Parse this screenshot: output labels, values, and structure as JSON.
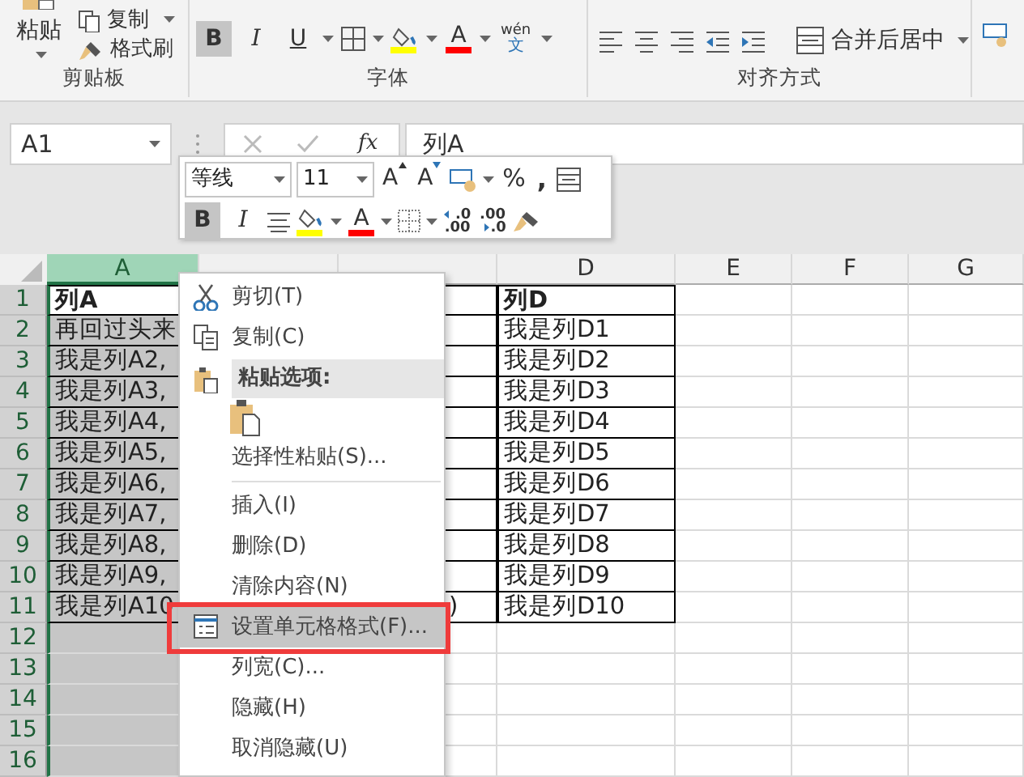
{
  "ribbon": {
    "clipboard": {
      "paste": "粘贴",
      "copy": "复制",
      "format_painter": "格式刷",
      "label": "剪贴板"
    },
    "font": {
      "label": "字体",
      "tools": [
        {
          "kind": "bold",
          "text": "B",
          "selected": true
        },
        {
          "kind": "italic",
          "text": "I",
          "selected": false
        },
        {
          "kind": "underline",
          "text": "U",
          "selected": false
        },
        {
          "kind": "borders"
        },
        {
          "kind": "fill"
        },
        {
          "kind": "font-color",
          "text": "A"
        },
        {
          "kind": "phonetic",
          "text": "wén",
          "sub": "文"
        }
      ]
    },
    "alignment": {
      "label": "对齐方式",
      "merge": "合并后居中"
    }
  },
  "formula_bar": {
    "name_box": "A1",
    "fx": "fx",
    "formula": "列A"
  },
  "mini_toolbar": {
    "font": "等线",
    "size": "11",
    "grow": "A",
    "shrink": "A",
    "percent": "%",
    "comma": ",",
    "tools": [
      {
        "kind": "bold",
        "text": "B",
        "selected": true
      },
      {
        "kind": "italic",
        "text": "I",
        "selected": false
      },
      {
        "kind": "center"
      },
      {
        "kind": "fill"
      },
      {
        "kind": "font-color",
        "text": "A"
      },
      {
        "kind": "borders"
      },
      {
        "kind": "inc-decimal",
        "top": ".0",
        "bottom": ".00"
      },
      {
        "kind": "dec-decimal",
        "top": ".00",
        "bottom": ".0"
      },
      {
        "kind": "painter"
      }
    ]
  },
  "sheet": {
    "columns": [
      {
        "label": "A",
        "selected": true
      },
      {
        "selected": false
      },
      {
        "selected": false
      },
      {
        "label": "D",
        "selected": false
      },
      {
        "label": "E",
        "selected": false
      },
      {
        "label": "F",
        "selected": false
      },
      {
        "label": "G",
        "selected": false
      }
    ],
    "rows": [
      {
        "label": "1",
        "kind": "header",
        "boxed": true,
        "a": "列A",
        "d": "列D"
      },
      {
        "label": "2",
        "boxed": true,
        "a": "再回过头来",
        "d": "我是列D1"
      },
      {
        "label": "3",
        "boxed": true,
        "a": "我是列A2,",
        "d": "我是列D2"
      },
      {
        "label": "4",
        "boxed": true,
        "a": "我是列A3,",
        "d": "我是列D3"
      },
      {
        "label": "5",
        "boxed": true,
        "a": "我是列A4,",
        "d": "我是列D4"
      },
      {
        "label": "6",
        "boxed": true,
        "a": "我是列A5,",
        "d": "我是列D5"
      },
      {
        "label": "7",
        "boxed": true,
        "a": "我是列A6,",
        "d": "我是列D6"
      },
      {
        "label": "8",
        "boxed": true,
        "a": "我是列A7,",
        "d": "我是列D7"
      },
      {
        "label": "9",
        "boxed": true,
        "a": "我是列A8,",
        "d": "我是列D8"
      },
      {
        "label": "10",
        "boxed": true,
        "a": "我是列A9,",
        "d": "我是列D9"
      },
      {
        "label": "11",
        "boxed": true,
        "a": "我是列A10",
        "c": ")",
        "d": "我是列D10"
      },
      {
        "label": "12",
        "boxed": false
      },
      {
        "label": "13",
        "boxed": false
      },
      {
        "label": "14",
        "boxed": false
      },
      {
        "label": "15",
        "boxed": false
      },
      {
        "label": "16",
        "boxed": false
      }
    ]
  },
  "context_menu": {
    "items": [
      {
        "kind": "cut",
        "label": "剪切(T)",
        "selected": false
      },
      {
        "kind": "copy",
        "label": "复制(C)",
        "selected": false
      },
      {
        "kind": "header",
        "label": "粘贴选项:"
      },
      {
        "kind": "paste-options"
      },
      {
        "kind": "command",
        "label": "选择性粘贴(S)...",
        "selected": false
      },
      {
        "kind": "separator"
      },
      {
        "kind": "command",
        "label": "插入(I)",
        "selected": false
      },
      {
        "kind": "command",
        "label": "删除(D)",
        "selected": false
      },
      {
        "kind": "command",
        "label": "清除内容(N)",
        "selected": false
      },
      {
        "kind": "format",
        "label": "设置单元格格式(F)...",
        "selected": true,
        "annotated": true
      },
      {
        "kind": "command",
        "label": "列宽(C)...",
        "selected": false
      },
      {
        "kind": "command",
        "label": "隐藏(H)",
        "selected": false
      },
      {
        "kind": "command",
        "label": "取消隐藏(U)",
        "selected": false
      }
    ]
  }
}
